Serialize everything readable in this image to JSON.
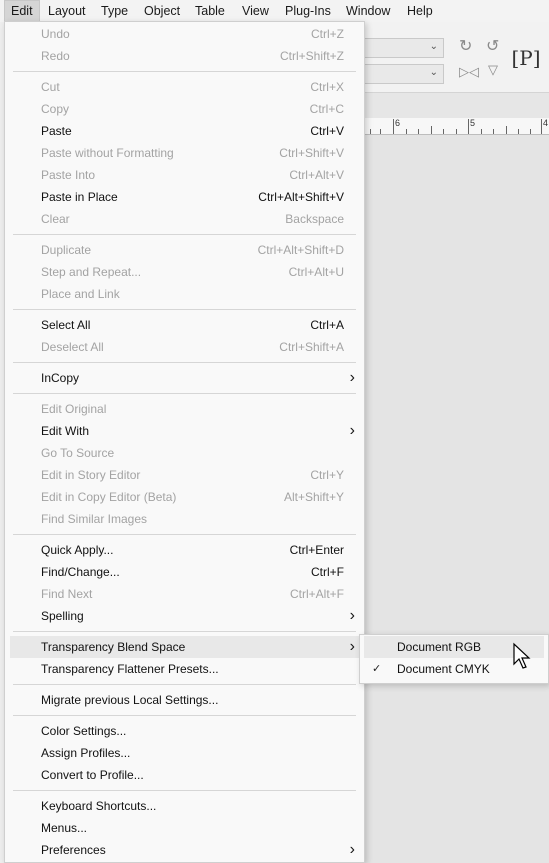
{
  "menubar": [
    "Edit",
    "Layout",
    "Type",
    "Object",
    "Table",
    "View",
    "Plug-Ins",
    "Window",
    "Help"
  ],
  "menubar_active": "Edit",
  "menu": {
    "items": [
      {
        "label": "Undo",
        "shortcut": "Ctrl+Z",
        "enabled": false,
        "submenu": false
      },
      {
        "label": "Redo",
        "shortcut": "Ctrl+Shift+Z",
        "enabled": false,
        "submenu": false
      },
      {
        "sep": true
      },
      {
        "label": "Cut",
        "shortcut": "Ctrl+X",
        "enabled": false,
        "submenu": false
      },
      {
        "label": "Copy",
        "shortcut": "Ctrl+C",
        "enabled": false,
        "submenu": false
      },
      {
        "label": "Paste",
        "shortcut": "Ctrl+V",
        "enabled": true,
        "submenu": false
      },
      {
        "label": "Paste without Formatting",
        "shortcut": "Ctrl+Shift+V",
        "enabled": false,
        "submenu": false
      },
      {
        "label": "Paste Into",
        "shortcut": "Ctrl+Alt+V",
        "enabled": false,
        "submenu": false
      },
      {
        "label": "Paste in Place",
        "shortcut": "Ctrl+Alt+Shift+V",
        "enabled": true,
        "submenu": false
      },
      {
        "label": "Clear",
        "shortcut": "Backspace",
        "enabled": false,
        "submenu": false
      },
      {
        "sep": true
      },
      {
        "label": "Duplicate",
        "shortcut": "Ctrl+Alt+Shift+D",
        "enabled": false,
        "submenu": false
      },
      {
        "label": "Step and Repeat...",
        "shortcut": "Ctrl+Alt+U",
        "enabled": false,
        "submenu": false
      },
      {
        "label": "Place and Link",
        "shortcut": "",
        "enabled": false,
        "submenu": false
      },
      {
        "sep": true
      },
      {
        "label": "Select All",
        "shortcut": "Ctrl+A",
        "enabled": true,
        "submenu": false
      },
      {
        "label": "Deselect All",
        "shortcut": "Ctrl+Shift+A",
        "enabled": false,
        "submenu": false
      },
      {
        "sep": true
      },
      {
        "label": "InCopy",
        "shortcut": "",
        "enabled": true,
        "submenu": true
      },
      {
        "sep": true
      },
      {
        "label": "Edit Original",
        "shortcut": "",
        "enabled": false,
        "submenu": false
      },
      {
        "label": "Edit With",
        "shortcut": "",
        "enabled": true,
        "submenu": true
      },
      {
        "label": "Go To Source",
        "shortcut": "",
        "enabled": false,
        "submenu": false
      },
      {
        "label": "Edit in Story Editor",
        "shortcut": "Ctrl+Y",
        "enabled": false,
        "submenu": false
      },
      {
        "label": "Edit in Copy Editor (Beta)",
        "shortcut": "Alt+Shift+Y",
        "enabled": false,
        "submenu": false
      },
      {
        "label": "Find Similar Images",
        "shortcut": "",
        "enabled": false,
        "submenu": false
      },
      {
        "sep": true
      },
      {
        "label": "Quick Apply...",
        "shortcut": "Ctrl+Enter",
        "enabled": true,
        "submenu": false
      },
      {
        "label": "Find/Change...",
        "shortcut": "Ctrl+F",
        "enabled": true,
        "submenu": false
      },
      {
        "label": "Find Next",
        "shortcut": "Ctrl+Alt+F",
        "enabled": false,
        "submenu": false
      },
      {
        "label": "Spelling",
        "shortcut": "",
        "enabled": true,
        "submenu": true
      },
      {
        "sep": true
      },
      {
        "label": "Transparency Blend Space",
        "shortcut": "",
        "enabled": true,
        "submenu": true,
        "highlight": true
      },
      {
        "label": "Transparency Flattener Presets...",
        "shortcut": "",
        "enabled": true,
        "submenu": false
      },
      {
        "sep": true
      },
      {
        "label": "Migrate previous Local Settings...",
        "shortcut": "",
        "enabled": true,
        "submenu": false
      },
      {
        "sep": true
      },
      {
        "label": "Color Settings...",
        "shortcut": "",
        "enabled": true,
        "submenu": false
      },
      {
        "label": "Assign Profiles...",
        "shortcut": "",
        "enabled": true,
        "submenu": false
      },
      {
        "label": "Convert to Profile...",
        "shortcut": "",
        "enabled": true,
        "submenu": false
      },
      {
        "sep": true
      },
      {
        "label": "Keyboard Shortcuts...",
        "shortcut": "",
        "enabled": true,
        "submenu": false
      },
      {
        "label": "Menus...",
        "shortcut": "",
        "enabled": true,
        "submenu": false
      },
      {
        "label": "Preferences",
        "shortcut": "",
        "enabled": true,
        "submenu": true
      }
    ]
  },
  "submenu": {
    "items": [
      {
        "label": "Document RGB",
        "checked": false,
        "highlight": true
      },
      {
        "label": "Document CMYK",
        "checked": true,
        "highlight": false
      }
    ]
  },
  "ruler_labels": [
    "6",
    "5",
    "4"
  ],
  "toolbar_glyph": "P"
}
